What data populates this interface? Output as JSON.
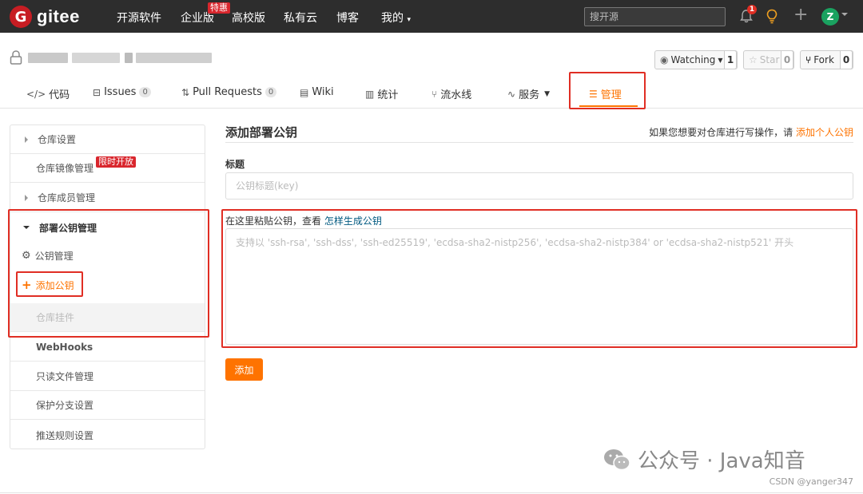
{
  "nav": {
    "logo_letter": "G",
    "logo_text": "gitee",
    "links": [
      "开源软件",
      "企业版",
      "高校版",
      "私有云",
      "博客"
    ],
    "hot_badge": "特惠",
    "my_menu": "我的",
    "search_placeholder": "搜开源",
    "notification_count": "1",
    "avatar_letter": "Z"
  },
  "repo": {
    "watch_label": "Watching",
    "watch_count": "1",
    "star_label": "Star",
    "star_count": "0",
    "fork_label": "Fork",
    "fork_count": "0"
  },
  "tabs": {
    "code": "代码",
    "issues": "Issues",
    "issues_count": "0",
    "pulls": "Pull Requests",
    "pulls_count": "0",
    "wiki": "Wiki",
    "stats": "统计",
    "pipeline": "流水线",
    "services": "服务",
    "manage": "管理"
  },
  "sidebar": {
    "repo_settings": "仓库设置",
    "mirror": "仓库镜像管理",
    "mirror_badge": "限时开放",
    "members": "仓库成员管理",
    "deploy_keys": "部署公钥管理",
    "key_manage": "公钥管理",
    "add_key": "添加公钥",
    "plugins": "仓库挂件",
    "webhooks": "WebHooks",
    "readonly": "只读文件管理",
    "protected": "保护分支设置",
    "push_rules": "推送规则设置"
  },
  "main": {
    "title": "添加部署公钥",
    "hint_text": "如果您想要对仓库进行写操作，请",
    "hint_link": "添加个人公钥",
    "title_label": "标题",
    "title_placeholder": "公钥标题(key)",
    "paste_label": "在这里粘贴公钥，查看",
    "paste_link": "怎样生成公钥",
    "key_placeholder": "支持以 'ssh-rsa', 'ssh-dss', 'ssh-ed25519', 'ecdsa-sha2-nistp256', 'ecdsa-sha2-nistp384' or 'ecdsa-sha2-nistp521' 开头",
    "add_button": "添加"
  },
  "watermark": {
    "text": "公众号 · Java知音",
    "csdn": "CSDN @yanger347"
  },
  "colors": {
    "accent": "#fe7300",
    "nav_bg": "#2d2d2d",
    "highlight_box": "#e02e24"
  }
}
